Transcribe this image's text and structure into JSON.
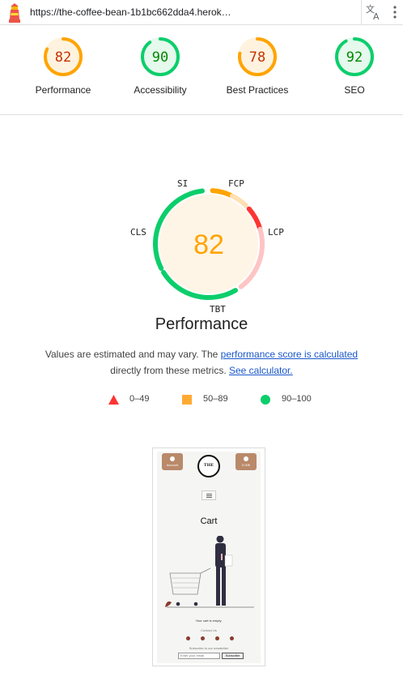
{
  "url_bar": {
    "url": "https://the-coffee-bean-1b1bc662dda4.herok…",
    "logo_icon": "lighthouse-icon",
    "translate_icon": "translate-icon",
    "menu_icon": "more-vert-icon"
  },
  "summary": {
    "gauges": [
      {
        "score": "82",
        "label": "Performance",
        "fraction": 0.82,
        "status": "average"
      },
      {
        "score": "90",
        "label": "Accessibility",
        "fraction": 0.9,
        "status": "pass"
      },
      {
        "score": "78",
        "label": "Best Practices",
        "fraction": 0.78,
        "status": "average"
      },
      {
        "score": "92",
        "label": "SEO",
        "fraction": 0.92,
        "status": "pass"
      }
    ]
  },
  "performance": {
    "score": "82",
    "title": "Performance",
    "metrics": {
      "si": "SI",
      "fcp": "FCP",
      "lcp": "LCP",
      "tbt": "TBT",
      "cls": "CLS"
    },
    "description_prefix": "Values are estimated and may vary. The ",
    "description_link": "performance score is calculated",
    "description_mid": "directly from these metrics. ",
    "calculator_link": "See calculator."
  },
  "legend": [
    {
      "range": "0–49",
      "shape": "triangle",
      "color": "#ff3333"
    },
    {
      "range": "50–89",
      "shape": "square",
      "color": "#ffaa33"
    },
    {
      "range": "90–100",
      "shape": "circle",
      "color": "#0cce6b"
    }
  ],
  "colors": {
    "pass": "#0cce6b",
    "pass_text": "#008800",
    "pass_bg": "#e5f9ed",
    "average": "#ffa400",
    "average_text": "#c33300",
    "average_bg": "#fff3e0",
    "fail": "#ff3333",
    "fail_light": "#ffc4c4"
  },
  "thumbnail": {
    "account_label": "Account",
    "basket_label": "0.00€",
    "logo_text": "THE",
    "cart_title": "Cart",
    "empty_text": "Your cart is empty.",
    "contact_text": "Contact Us",
    "subscribe_text": "Subscribe to our newsletter",
    "email_placeholder": "Enter your email",
    "subscribe_button": "Subscribe"
  }
}
